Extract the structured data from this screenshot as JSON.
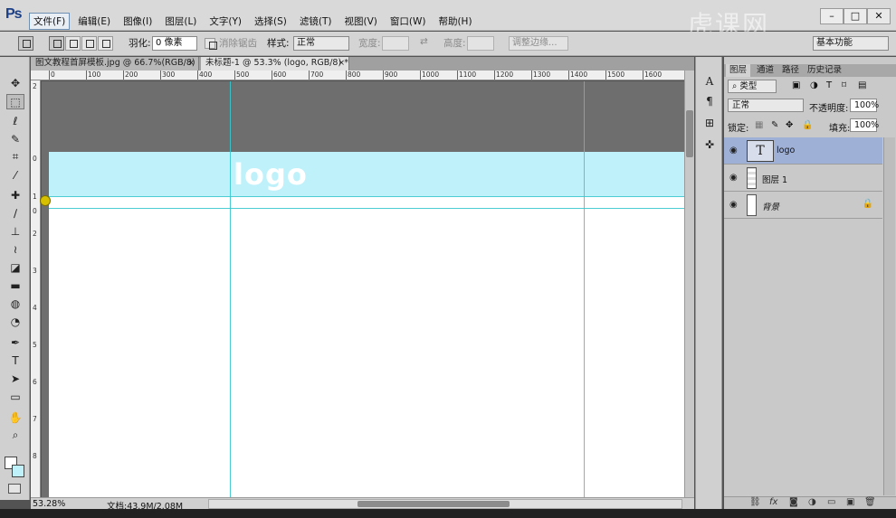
{
  "app": {
    "logo": "Ps",
    "watermark": "虎课网"
  },
  "menu": {
    "items": [
      "文件(F)",
      "编辑(E)",
      "图像(I)",
      "图层(L)",
      "文字(Y)",
      "选择(S)",
      "滤镜(T)",
      "视图(V)",
      "窗口(W)",
      "帮助(H)"
    ],
    "active_index": 0
  },
  "window_controls": {
    "minimize": "–",
    "restore": "□",
    "close": "✕"
  },
  "options": {
    "feather_label": "羽化:",
    "feather_value": "0 像素",
    "antialias_label": "消除锯齿",
    "style_label": "样式:",
    "style_value": "正常",
    "width_label": "宽度:",
    "height_label": "高度:",
    "refine_button": "调整边缘...",
    "workspace_value": "基本功能"
  },
  "tabs": [
    {
      "label": "图文教程首屏模板.jpg @ 66.7%(RGB/8)",
      "close": "×",
      "active": false
    },
    {
      "label": "未标题-1 @ 53.3% (logo, RGB/8) *",
      "close": "×",
      "active": true
    }
  ],
  "ruler_top": [
    "0",
    "100",
    "200",
    "300",
    "400",
    "500",
    "600",
    "700",
    "800",
    "900",
    "1000",
    "1100",
    "1200",
    "1300",
    "1400",
    "1500",
    "1600"
  ],
  "ruler_left": [
    "2",
    "0",
    "1",
    "0",
    "2",
    "3",
    "4",
    "5",
    "6",
    "7",
    "8"
  ],
  "canvas": {
    "logo_text": "logo",
    "band_color": "#bff1fb",
    "guide_color": "#39c8cf"
  },
  "status": {
    "zoom": "53.28%",
    "doc_info": "文档:43.9M/2.08M"
  },
  "tools": [
    {
      "icon": "move-icon",
      "glyph": "✥"
    },
    {
      "icon": "marquee-icon",
      "glyph": "⬚"
    },
    {
      "icon": "lasso-icon",
      "glyph": "ℓ"
    },
    {
      "icon": "quick-select-icon",
      "glyph": "✎"
    },
    {
      "icon": "crop-icon",
      "glyph": "⌗"
    },
    {
      "icon": "eyedropper-icon",
      "glyph": "⁄"
    },
    {
      "icon": "healing-icon",
      "glyph": "✚"
    },
    {
      "icon": "brush-icon",
      "glyph": "∕"
    },
    {
      "icon": "stamp-icon",
      "glyph": "⊥"
    },
    {
      "icon": "history-brush-icon",
      "glyph": "≀"
    },
    {
      "icon": "eraser-icon",
      "glyph": "◪"
    },
    {
      "icon": "gradient-icon",
      "glyph": "▬"
    },
    {
      "icon": "blur-icon",
      "glyph": "◍"
    },
    {
      "icon": "dodge-icon",
      "glyph": "◔"
    },
    {
      "icon": "pen-icon",
      "glyph": "✒"
    },
    {
      "icon": "type-icon",
      "glyph": "T"
    },
    {
      "icon": "path-select-icon",
      "glyph": "➤"
    },
    {
      "icon": "rectangle-icon",
      "glyph": "▭"
    },
    {
      "icon": "hand-icon",
      "glyph": "✋"
    },
    {
      "icon": "zoom-icon",
      "glyph": "⌕"
    }
  ],
  "panel": {
    "tabs": [
      "图层",
      "通道",
      "路径",
      "历史记录"
    ],
    "filter_label": "类型",
    "blend_mode": "正常",
    "opacity_label": "不透明度:",
    "opacity_value": "100%",
    "lock_label": "锁定:",
    "fill_label": "填充:",
    "fill_value": "100%",
    "layers": [
      {
        "name": "logo",
        "kind": "type",
        "selected": true,
        "locked": false,
        "thumb_glyph": "T"
      },
      {
        "name": "图层 1",
        "kind": "pixel",
        "selected": false,
        "locked": false,
        "thumb_glyph": ""
      },
      {
        "name": "背景",
        "kind": "background",
        "selected": false,
        "locked": true,
        "thumb_glyph": ""
      }
    ],
    "footer_icons": [
      "link-icon",
      "fx-icon",
      "mask-icon",
      "adjustment-icon",
      "group-icon",
      "new-layer-icon",
      "trash-icon"
    ],
    "footer_glyphs": [
      "⛓",
      "fx",
      "◙",
      "◑",
      "▭",
      "▣",
      "🗑"
    ]
  }
}
